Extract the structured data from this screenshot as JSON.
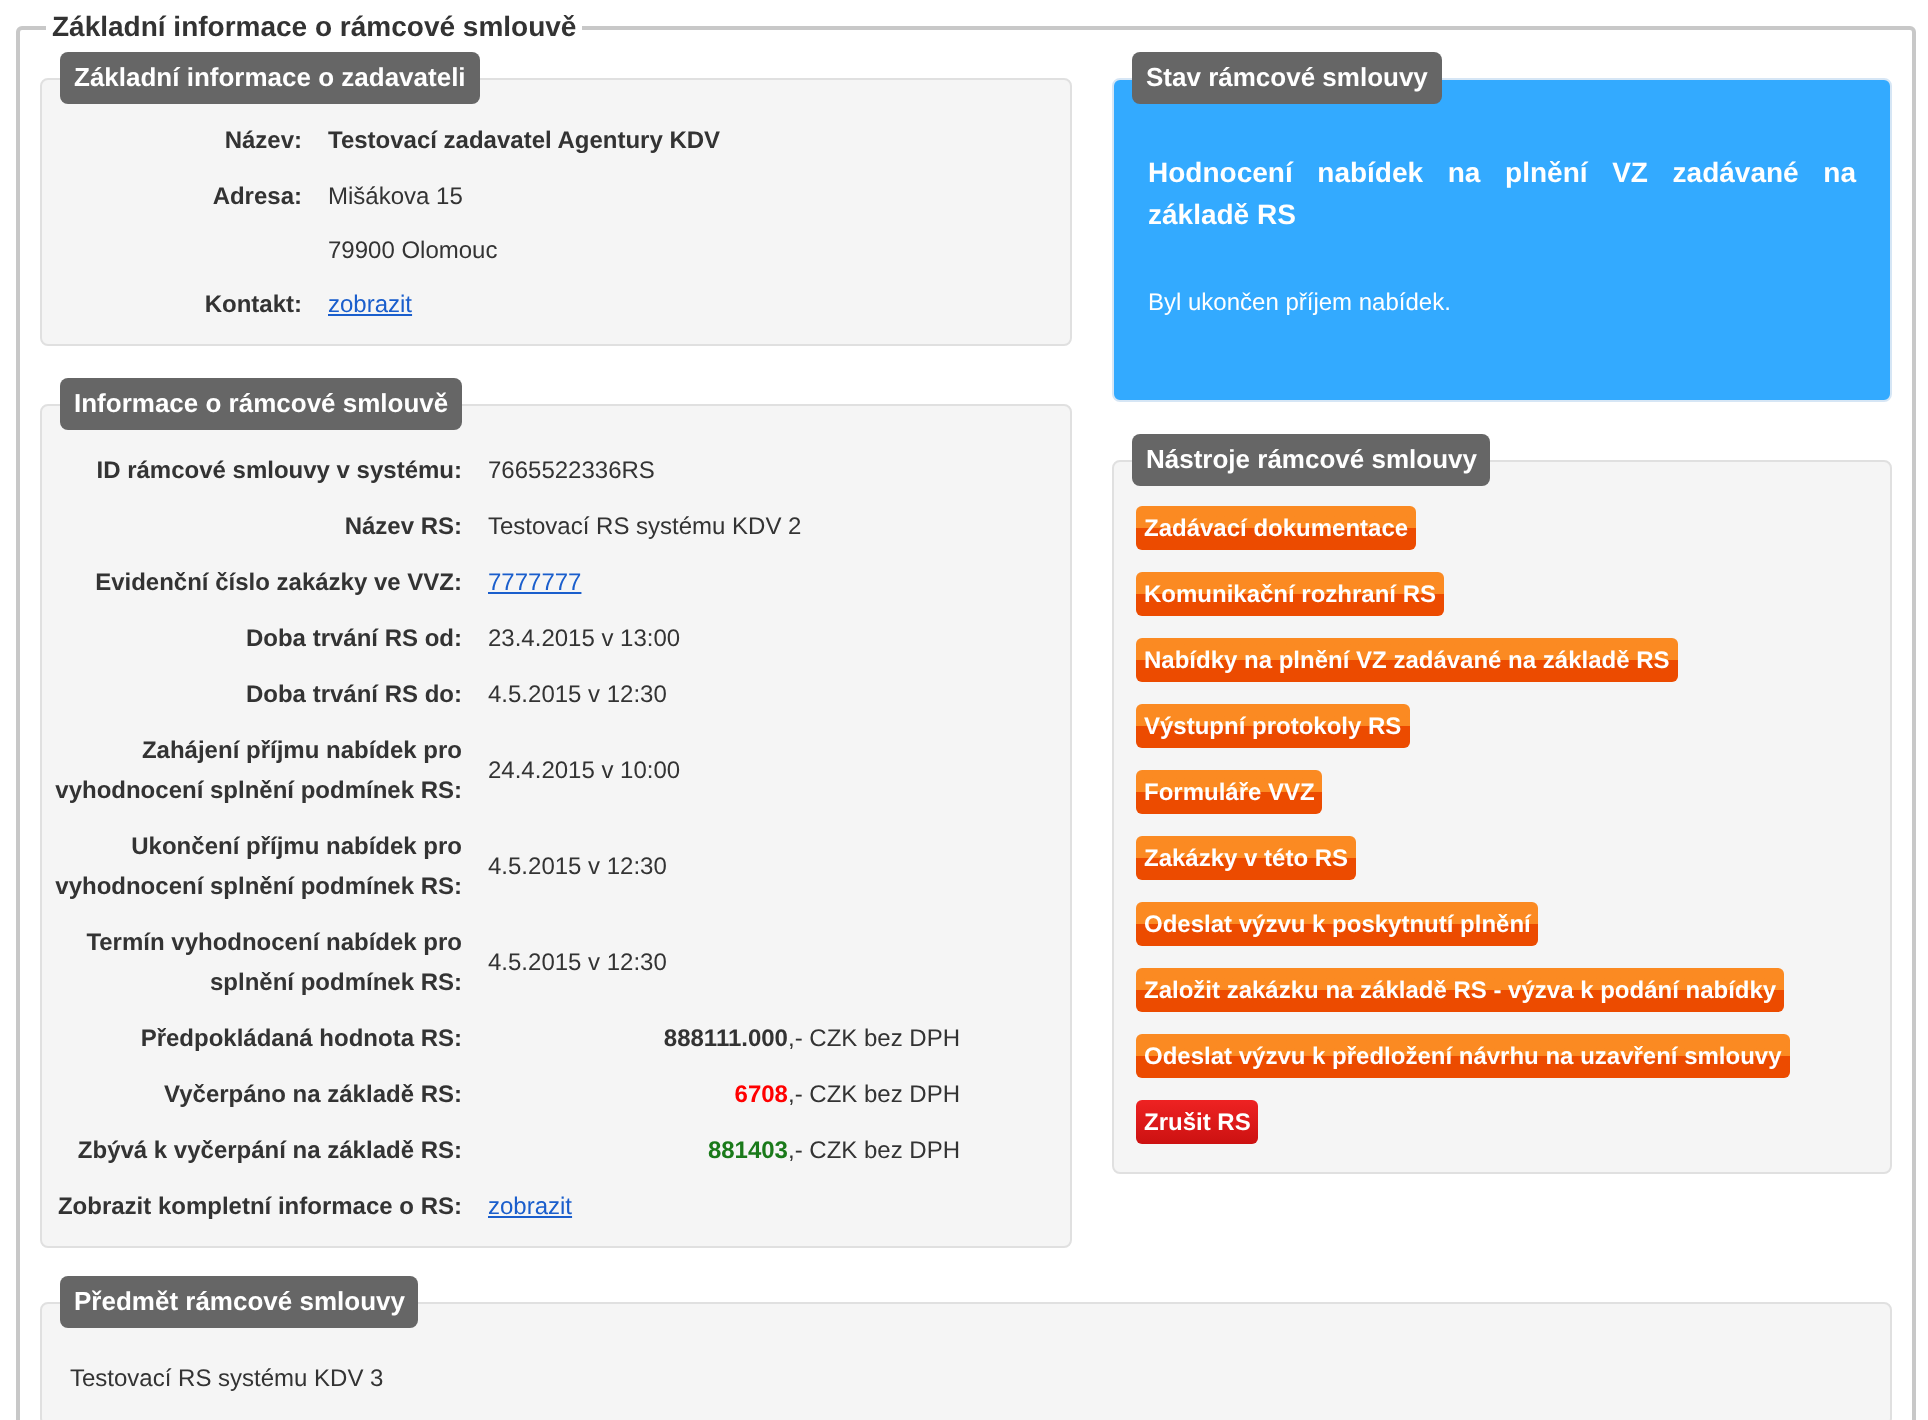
{
  "legend": "Základní informace o rámcové smlouvě",
  "zadavatel": {
    "title": "Základní informace o zadavateli",
    "rows": [
      {
        "kind": "bold",
        "label": "Název:",
        "value": "Testovací zadavatel Agentury KDV"
      },
      {
        "kind": "text",
        "label": "Adresa:",
        "value": "Mišákova 15"
      },
      {
        "kind": "text",
        "label": "",
        "value": "79900 Olomouc"
      },
      {
        "kind": "link",
        "label": "Kontakt:",
        "value": "zobrazit"
      }
    ]
  },
  "informace": {
    "title": "Informace o rámcové smlouvě",
    "rows": [
      {
        "kind": "text",
        "label": "ID rámcové smlouvy v systému:",
        "value": "7665522336RS"
      },
      {
        "kind": "text",
        "label": "Název RS:",
        "value": "Testovací RS systému KDV 2"
      },
      {
        "kind": "link",
        "label": "Evidenční číslo zakázky ve VVZ:",
        "value": "7777777"
      },
      {
        "kind": "text",
        "label": "Doba trvání RS od:",
        "value": "23.4.2015 v 13:00"
      },
      {
        "kind": "text",
        "label": "Doba trvání RS do:",
        "value": "4.5.2015 v 12:30"
      },
      {
        "kind": "text",
        "label": "Zahájení příjmu nabídek pro vyhodnocení splnění podmínek RS:",
        "value": "24.4.2015 v 10:00"
      },
      {
        "kind": "text",
        "label": "Ukončení příjmu nabídek pro vyhodnocení splnění podmínek RS:",
        "value": "4.5.2015 v 12:30"
      },
      {
        "kind": "text",
        "label": "Termín vyhodnocení nabídek pro splnění podmínek RS:",
        "value": "4.5.2015 v 12:30"
      },
      {
        "kind": "amount",
        "label": "Předpokládaná hodnota RS:",
        "value": "888111.000",
        "suffix": ",- CZK bez DPH",
        "color": "#333333"
      },
      {
        "kind": "amount",
        "label": "Vyčerpáno na základě RS:",
        "value": "6708",
        "suffix": ",- CZK bez DPH",
        "color": "#ff0000"
      },
      {
        "kind": "amount",
        "label": "Zbývá k vyčerpání na základě RS:",
        "value": "881403",
        "suffix": ",- CZK bez DPH",
        "color": "#1a7a1a"
      },
      {
        "kind": "link",
        "label": "Zobrazit kompletní informace o RS:",
        "value": "zobrazit"
      }
    ]
  },
  "stav": {
    "title": "Stav rámcové smlouvy",
    "heading": "Hodnocení nabídek na plnění VZ zadávané na základě RS",
    "text": "Byl ukončen příjem nabídek."
  },
  "nastroje": {
    "title": "Nástroje rámcové smlouvy",
    "buttons": [
      {
        "kind": "normal",
        "label": "Zadávací dokumentace"
      },
      {
        "kind": "normal",
        "label": "Komunikační rozhraní RS"
      },
      {
        "kind": "normal",
        "label": "Nabídky na plnění VZ zadávané na základě RS"
      },
      {
        "kind": "normal",
        "label": "Výstupní protokoly RS"
      },
      {
        "kind": "normal",
        "label": "Formuláře VVZ"
      },
      {
        "kind": "normal",
        "label": "Zakázky v této RS"
      },
      {
        "kind": "normal",
        "label": "Odeslat výzvu k poskytnutí plnění"
      },
      {
        "kind": "normal",
        "label": "Založit zakázku na základě RS - výzva k podání nabídky"
      },
      {
        "kind": "normal",
        "label": "Odeslat výzvu k předložení návrhu na uzavření smlouvy"
      },
      {
        "kind": "danger",
        "label": "Zrušit RS"
      }
    ]
  },
  "predmet": {
    "title": "Předmět rámcové smlouvy",
    "text": "Testovací RS systému KDV 3"
  }
}
